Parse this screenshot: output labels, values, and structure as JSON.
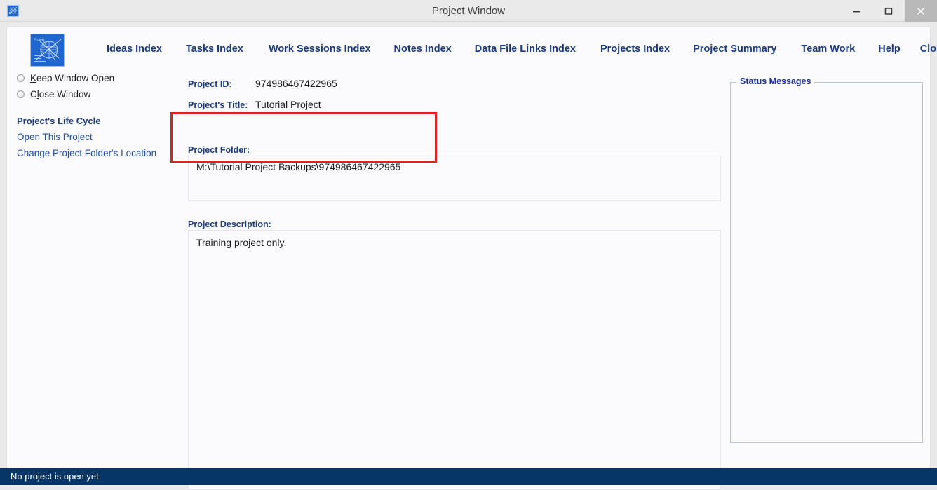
{
  "window": {
    "title": "Project Window",
    "icon": "project-diagram-icon",
    "controls": {
      "minimize": "minimize-icon",
      "maximize": "maximize-icon",
      "close": "close-icon"
    }
  },
  "header": {
    "logo_alt": "project-diagram-logo",
    "menu": [
      {
        "label": "Ideas Index",
        "accel": "I",
        "accel_index": 0
      },
      {
        "label": "Tasks Index",
        "accel": "T",
        "accel_index": 0
      },
      {
        "label": "Work Sessions Index",
        "accel": "W",
        "accel_index": 0
      },
      {
        "label": "Notes Index",
        "accel": "N",
        "accel_index": 0
      },
      {
        "label": "Data File Links Index",
        "accel": "D",
        "accel_index": 0
      },
      {
        "label": "Projects Index",
        "accel": "",
        "accel_index": -1
      },
      {
        "label": "Project Summary",
        "accel": "P",
        "accel_index": 0
      },
      {
        "label": "Team Work",
        "accel": "e",
        "accel_index": 1
      },
      {
        "label": "Help",
        "accel": "H",
        "accel_index": 0
      },
      {
        "label": "Close Program",
        "accel": "C",
        "accel_index": 0
      }
    ]
  },
  "sidebar": {
    "radios": [
      {
        "label": "Keep Window Open",
        "accel_index": 0,
        "selected": false
      },
      {
        "label": "Close Window",
        "accel_index": 1,
        "selected": false
      }
    ],
    "section_heading": "Project's Life Cycle",
    "links": [
      "Open This Project",
      "Change Project Folder's Location"
    ]
  },
  "main": {
    "project_id_label": "Project ID:",
    "project_id_value": "974986467422965",
    "project_title_label": "Project's Title:",
    "project_title_value": "Tutorial Project",
    "project_folder_label": "Project Folder:",
    "project_folder_value": "M:\\Tutorial Project Backups\\974986467422965",
    "project_description_label": "Project Description:",
    "project_description_value": "Training project only."
  },
  "status_panel": {
    "legend": "Status Messages",
    "messages": ""
  },
  "statusbar": {
    "message": "No project is open yet."
  },
  "colors": {
    "accent_blue": "#1a3a80",
    "link_blue": "#1f4fa8",
    "statusbar_navy": "#063567",
    "highlight_red": "#e02020",
    "logo_blue": "#1f66d0"
  }
}
